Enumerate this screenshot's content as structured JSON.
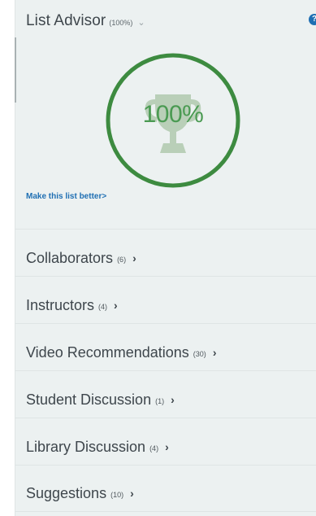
{
  "advisor": {
    "title": "List Advisor",
    "score_label": "(100%)",
    "percent_text": "100%",
    "progress": 1.0,
    "improve_link": "Make this list better",
    "improve_chevron": ">"
  },
  "help_icon": "?",
  "colors": {
    "ring": "#3d8b40",
    "trophy": "#b9cfb8",
    "percent_text": "#4a9a52",
    "link": "#1f6fb3"
  },
  "menu": [
    {
      "label": "Collaborators",
      "count": "(6)",
      "chevron": "›"
    },
    {
      "label": "Instructors",
      "count": "(4)",
      "chevron": "›"
    },
    {
      "label": "Video Recommendations",
      "count": "(30)",
      "chevron": "›"
    },
    {
      "label": "Student Discussion",
      "count": "(1)",
      "chevron": "›"
    },
    {
      "label": "Library Discussion",
      "count": "(4)",
      "chevron": "›"
    },
    {
      "label": "Suggestions",
      "count": "(10)",
      "chevron": "›"
    }
  ]
}
